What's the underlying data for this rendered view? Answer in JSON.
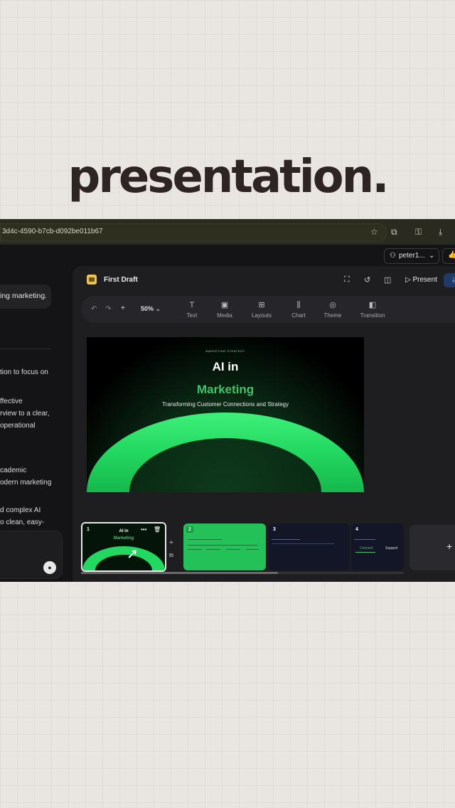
{
  "headline": "presentation.",
  "browser": {
    "url": "3d4c-4590-b7cb-d092be011b67",
    "icons": [
      "star-icon",
      "puzzle-icon",
      "key-icon",
      "download-icon"
    ]
  },
  "topbar": {
    "user": "peter1...",
    "user_icon": "user-icon",
    "chevron": "chevron-down-icon",
    "like_icon": "thumbs-up-icon"
  },
  "chat": {
    "bubble": "ing marketing.",
    "lines": [
      "tion to focus on",
      "ffective",
      "rview to a clear,",
      "operational",
      "cademic",
      "odern marketing",
      "d complex AI",
      "o clean, easy-"
    ],
    "mic_icon": "mic-icon"
  },
  "editor": {
    "doc_title": "First Draft",
    "present_label": "Present",
    "zoom": "50%",
    "tools": [
      {
        "glyph": "T",
        "label": "Text"
      },
      {
        "glyph": "▣",
        "label": "Media"
      },
      {
        "glyph": "⊞",
        "label": "Layouts"
      },
      {
        "glyph": "⫼",
        "label": "Chart"
      },
      {
        "glyph": "◎",
        "label": "Theme"
      },
      {
        "glyph": "◧",
        "label": "Transition"
      }
    ]
  },
  "slide": {
    "eyebrow": "MARKETING STRATEGY",
    "title_line1": "AI in",
    "title_line2": "Marketing",
    "subtitle": "Transforming Customer Connections and Strategy",
    "accent": "#1fd35b"
  },
  "filmstrip": {
    "thumbs": [
      {
        "num": "1",
        "t1": "AI in",
        "t2": "Marketing"
      },
      {
        "num": "2"
      },
      {
        "num": "3"
      },
      {
        "num": "4",
        "a": "Connect",
        "b": "Support"
      }
    ],
    "add_label": "+",
    "scroll_fraction": 0.61
  }
}
